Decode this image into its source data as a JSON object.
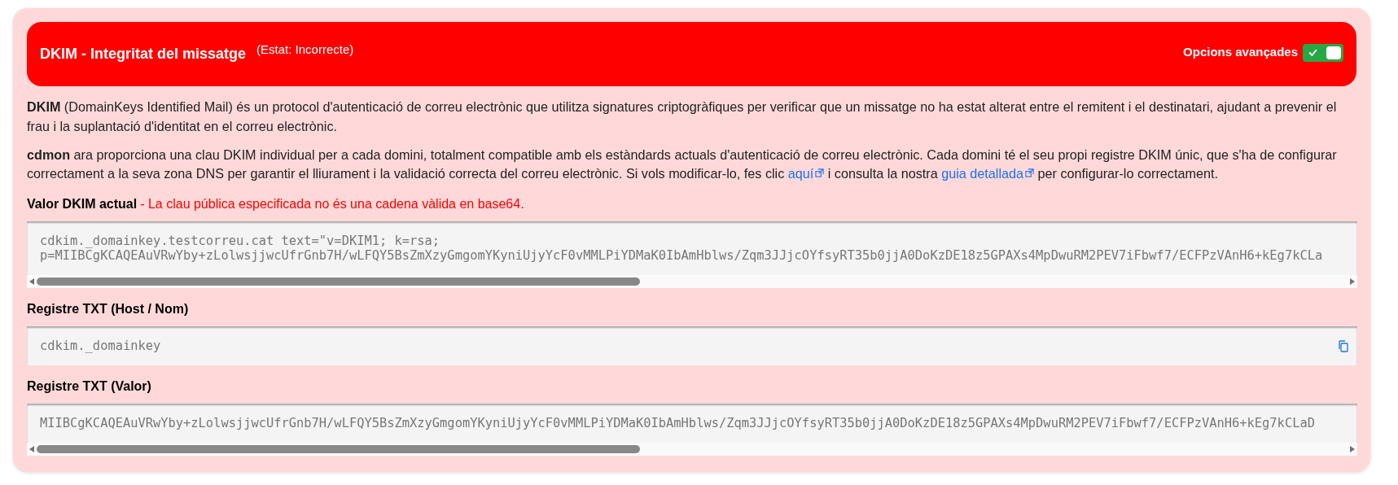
{
  "header": {
    "title": "DKIM - Integritat del missatge",
    "status_text": "(Estat: Incorrecte)",
    "toggle": {
      "label": "Opcions avançades",
      "on": true
    }
  },
  "intro": "**DKIM** (DomainKeys Identified Mail) és un protocol d'autenticació de correu electrònic que utilitza signatures criptogràfiques per verificar que un missatge no ha estat alterat entre el remitent i el destinatari, ajudant a prevenir el frau i la suplantació d'identitat en el correu electrònic.",
  "details": [
    {
      "kind": "text",
      "text": "**cdmon** ara proporciona una clau DKIM individual per a cada domini, totalment compatible amb els estàndards actuals d'autenticació de correu electrònic. Cada domini té el seu propi registre DKIM únic, que s'ha de configurar correctament a la seva zona DNS per garantir el lliurament i la validació correcta del correu electrònic. Si vols modificar-lo, fes clic "
    },
    {
      "kind": "link",
      "text": "aquí"
    },
    {
      "kind": "text",
      "text": " i consulta la nostra "
    },
    {
      "kind": "link",
      "text": "guia detallada"
    },
    {
      "kind": "text",
      "text": " per configurar-lo correctament."
    }
  ],
  "fields": [
    {
      "label": "Valor DKIM actual",
      "error": "- La clau pública especificada no és una cadena vàlida en base64.",
      "lines": [
        "cdkim._domainkey.testcorreu.cat text=\"v=DKIM1; k=rsa;",
        "p=MIIBCgKCAQEAuVRwYby+zLolwsjjwcUfrGnb7H/wLFQY5BsZmXzyGmgomYKyniUjyYcF0vMMLPiYDMaK0IbAmHblws/Zqm3JJjcOYfsyRT35b0jjA0DoKzDE18z5GPAXs4MpDwuRM2PEV7iFbwf7/ECFPzVAnH6+kEg7kCLa"
      ],
      "kind": "scrollable"
    },
    {
      "label": "Registre TXT (Host / Nom)",
      "lines": [
        "cdkim._domainkey"
      ],
      "kind": "copyable"
    },
    {
      "label": "Registre TXT (Valor)",
      "lines": [
        "MIIBCgKCAQEAuVRwYby+zLolwsjjwcUfrGnb7H/wLFQY5BsZmXzyGmgomYKyniUjyYcF0vMMLPiYDMaK0IbAmHblws/Zqm3JJjcOYfsyRT35b0jjA0DoKzDE18z5GPAXs4MpDwuRM2PEV7iFbwf7/ECFPzVAnH6+kEg7kCLaD"
      ],
      "kind": "scrollable"
    }
  ]
}
